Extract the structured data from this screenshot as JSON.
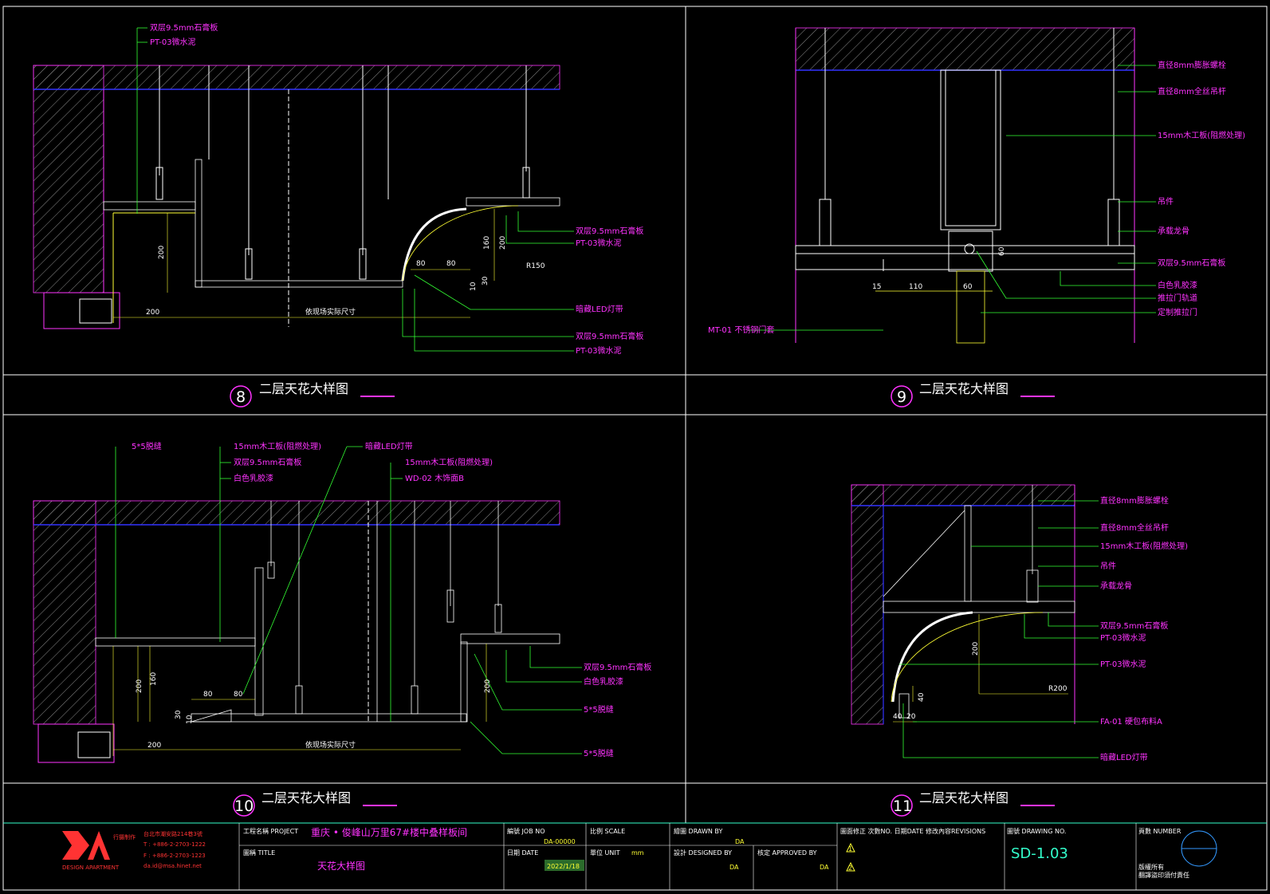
{
  "details": [
    {
      "number": "8",
      "title": "二层天花大样图",
      "labels": [
        "双层9.5mm石膏板",
        "PT-03微水泥",
        "双层9.5mm石膏板",
        "PT-03微水泥",
        "暗藏LED灯带",
        "双层9.5mm石膏板",
        "PT-03微水泥"
      ],
      "dims": [
        "200",
        "200",
        "依现场实际尺寸",
        "80",
        "80",
        "160",
        "200",
        "R150",
        "10",
        "30"
      ]
    },
    {
      "number": "9",
      "title": "二层天花大样图",
      "labels": [
        "直径8mm膨胀螺栓",
        "直径8mm全丝吊杆",
        "15mm木工板(阻燃处理)",
        "吊件",
        "承载龙骨",
        "双层9.5mm石膏板",
        "白色乳胶漆",
        "推拉门轨道",
        "定制推拉门",
        "MT-01 不锈钢门套"
      ],
      "dims": [
        "15",
        "110",
        "60",
        "60"
      ]
    },
    {
      "number": "10",
      "title": "二层天花大样图",
      "labels": [
        "5*5脱缝",
        "15mm木工板(阻燃处理)",
        "双层9.5mm石膏板",
        "白色乳胶漆",
        "暗藏LED灯带",
        "15mm木工板(阻燃处理)",
        "WD-02 木饰面B",
        "双层9.5mm石膏板",
        "白色乳胶漆",
        "5*5脱缝",
        "5*5脱缝"
      ],
      "dims": [
        "160",
        "200",
        "80",
        "80",
        "30",
        "10",
        "200",
        "依现场实际尺寸",
        "200"
      ]
    },
    {
      "number": "11",
      "title": "二层天花大样图",
      "labels": [
        "直径8mm膨胀螺栓",
        "直径8mm全丝吊杆",
        "15mm木工板(阻燃处理)",
        "吊件",
        "承载龙骨",
        "双层9.5mm石膏板",
        "PT-03微水泥",
        "PT-03微水泥",
        "FA-01 硬包布料A",
        "暗藏LED灯带"
      ],
      "dims": [
        "200",
        "R200",
        "40",
        "40",
        "20"
      ]
    }
  ],
  "title_block": {
    "company_cn": "行摄制作",
    "company_en": "DESIGN APARTMENT",
    "address": "台北市潮安路214巷3號",
    "tel": "T : +886-2-2703-1222",
    "fax": "F : +886-2-2703-1223",
    "email": "da.id@msa.hinet.net",
    "project_label": "工程名稱 PROJECT",
    "project_value": "重庆 • 俊峰山万里67#楼中叠样板间",
    "title_label": "圖稱 TITLE",
    "title_value": "天花大样图",
    "job_label": "編號 JOB NO",
    "job_value": "DA-00000",
    "date_label": "日期 DATE",
    "date_value": "2022/1/18",
    "scale_label": "比例 SCALE",
    "unit_label": "單位 UNIT",
    "unit_value": "mm",
    "drawn_label": "繪圖 DRAWN BY",
    "drawn_value": "DA",
    "designed_label": "設計 DESIGNED BY",
    "designed_value": "DA",
    "approved_label": "核定 APPROVED BY",
    "approved_value": "DA",
    "revisions_label": "圖面修正 次數NO. 日期DATE 修改內容REVISIONS",
    "rev1": "1",
    "rev2": "2",
    "drawing_no_label": "圖號 DRAWING NO.",
    "drawing_no_value": "SD-1.03",
    "number_label": "頁數 NUMBER",
    "copyright_1": "版權所有",
    "copyright_2": "翻譯盜印須付責任"
  },
  "colors": {
    "magenta": "#ff33ff",
    "green": "#33ff33",
    "yellow": "#ffff33",
    "blue": "#3333ff",
    "cyan": "#33ffcc",
    "white": "#ffffff",
    "red": "#ff3333"
  }
}
